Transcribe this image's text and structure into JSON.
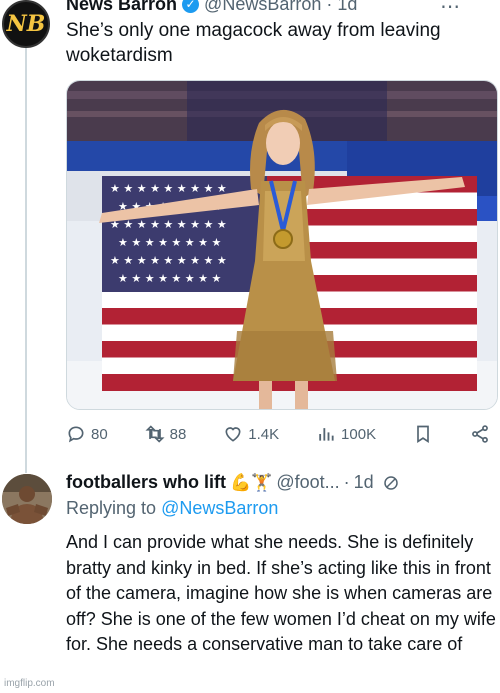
{
  "tweet": {
    "author_name": "News Barron",
    "avatar_text": "NB",
    "handle": "@NewsBarron",
    "separator": "·",
    "time": "1d",
    "text": "She’s only one magacock away from leaving woketardism",
    "image_alt": "Figure skater in a gold dress and medal holding a large American flag",
    "stats": {
      "replies": "80",
      "retweets": "88",
      "likes": "1.4K",
      "views": "100K"
    }
  },
  "reply": {
    "author_name": "footballers who lift",
    "emojis": "💪🏋",
    "handle": "@foot...",
    "separator": "·",
    "time": "1d",
    "replying_to_label": "Replying to",
    "replying_to_handle": "@NewsBarron",
    "text": "And I can provide what she needs. She is definitely bratty and kinky in bed. If she’s acting like this in front of the camera, imagine how she is when cameras are off? She is one of the few women I’d cheat on my wife for. She needs a conservative man to take care of"
  },
  "watermark": "imgflip.com",
  "colors": {
    "accent": "#1d9bf0",
    "muted": "#536471",
    "flag_red": "#b22234",
    "flag_blue": "#3c3b6e"
  }
}
